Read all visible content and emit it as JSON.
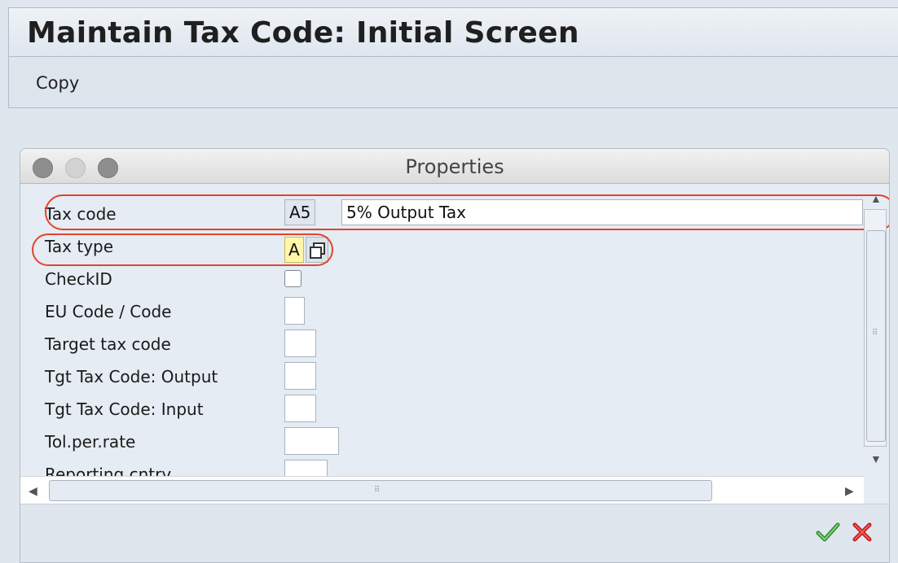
{
  "window": {
    "title": "Maintain Tax Code: Initial Screen"
  },
  "toolbar": {
    "copy_label": "Copy"
  },
  "dialog": {
    "title": "Properties",
    "fields": {
      "tax_code": {
        "label": "Tax code",
        "code": "A5",
        "description": "5% Output Tax"
      },
      "tax_type": {
        "label": "Tax type",
        "value": "A"
      },
      "check_id": {
        "label": "CheckID"
      },
      "eu_code": {
        "label": "EU Code / Code",
        "value": ""
      },
      "target_tax_code": {
        "label": "Target tax code",
        "value": ""
      },
      "tgt_output": {
        "label": "Tgt Tax Code: Output",
        "value": ""
      },
      "tgt_input": {
        "label": "Tgt Tax Code: Input",
        "value": ""
      },
      "tol_rate": {
        "label": "Tol.per.rate",
        "value": ""
      },
      "reporting_cntry": {
        "label": "Reporting cntry",
        "value": ""
      }
    }
  },
  "annotation_color": "#e2442c",
  "icons": [
    "f4-help-icon",
    "checkmark-icon",
    "cancel-x-icon"
  ]
}
